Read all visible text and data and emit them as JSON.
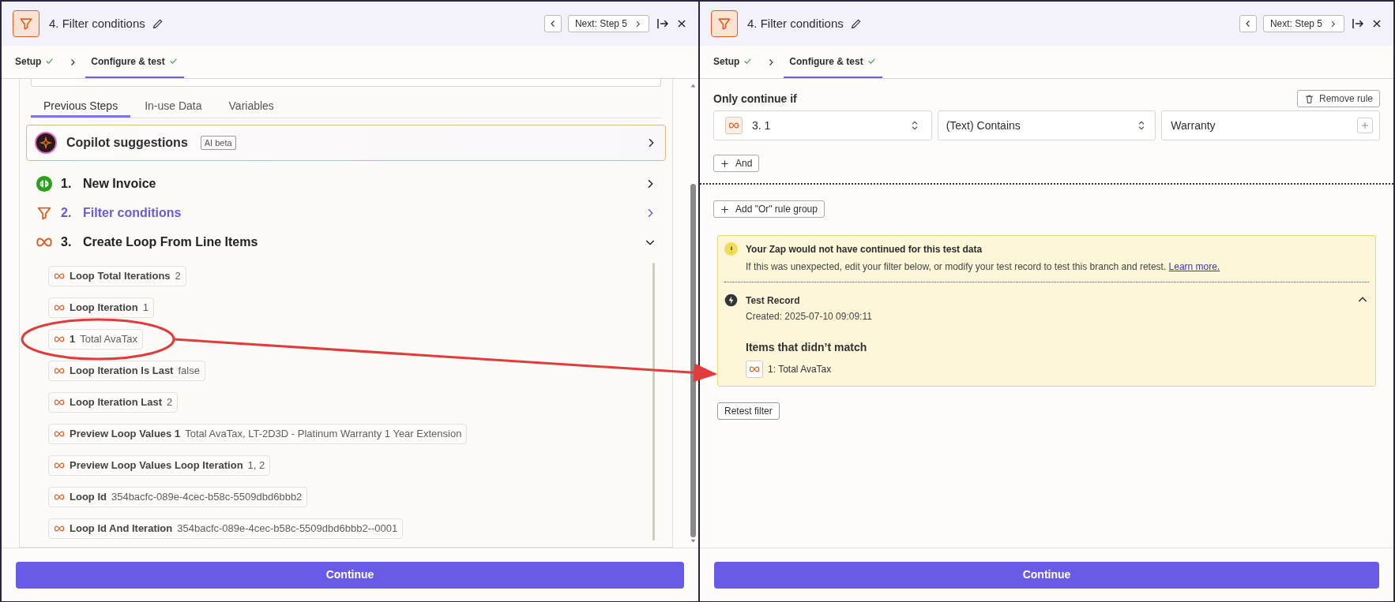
{
  "left_panel": {
    "header": {
      "title": "4. Filter conditions",
      "next_label": "Next: Step 5"
    },
    "tabs": [
      {
        "label": "Setup",
        "done": true,
        "selected": false
      },
      {
        "label": "Configure & test",
        "done": true,
        "selected": true
      }
    ],
    "data_tabs": [
      {
        "label": "Previous Steps",
        "selected": true
      },
      {
        "label": "In-use Data",
        "selected": false
      },
      {
        "label": "Variables",
        "selected": false
      }
    ],
    "copilot": {
      "title": "Copilot suggestions",
      "badge": "AI beta"
    },
    "steps": [
      {
        "number": "1.",
        "title": "New Invoice",
        "kind": "quickbooks",
        "selected": false,
        "expanded": false
      },
      {
        "number": "2.",
        "title": "Filter conditions",
        "kind": "filter",
        "selected": true,
        "expanded": false
      },
      {
        "number": "3.",
        "title": "Create Loop From Line Items",
        "kind": "loop",
        "selected": false,
        "expanded": true
      }
    ],
    "fields": [
      {
        "label": "Loop Total Iterations",
        "value": "2"
      },
      {
        "label": "Loop Iteration",
        "value": "1"
      },
      {
        "label": "1",
        "value": "Total AvaTax"
      },
      {
        "label": "Loop Iteration Is Last",
        "value": "false"
      },
      {
        "label": "Loop Iteration Last",
        "value": "2"
      },
      {
        "label": "Preview Loop Values 1",
        "value": "Total AvaTax, LT-2D3D - Platinum Warranty 1 Year Extension"
      },
      {
        "label": "Preview Loop Values Loop Iteration",
        "value": "1, 2"
      },
      {
        "label": "Loop Id",
        "value": "354bacfc-089e-4cec-b58c-5509dbd6bbb2"
      },
      {
        "label": "Loop Id And Iteration",
        "value": "354bacfc-089e-4cec-b58c-5509dbd6bbb2--0001"
      }
    ],
    "continue": "Continue"
  },
  "right_panel": {
    "header": {
      "title": "4. Filter conditions",
      "next_label": "Next: Step 5"
    },
    "tabs": [
      {
        "label": "Setup",
        "done": true,
        "selected": false
      },
      {
        "label": "Configure & test",
        "done": true,
        "selected": true
      }
    ],
    "rule": {
      "heading": "Only continue if",
      "remove": "Remove rule",
      "field": "3. 1",
      "operator": "(Text) Contains",
      "value": "Warranty",
      "and_button": "And"
    },
    "or_button": "Add \"Or\" rule group",
    "alert": {
      "title": "Your Zap would not have continued for this test data",
      "message": "If this was unexpected, edit your filter below, or modify your test record to test this branch and retest.",
      "link": "Learn more."
    },
    "record": {
      "title": "Test Record",
      "created": "Created: 2025-07-10 09:09:11",
      "expanded": true,
      "items_heading": "Items that didn’t match",
      "items": [
        "1: Total AvaTax"
      ]
    },
    "retest": "Retest filter",
    "continue": "Continue"
  }
}
